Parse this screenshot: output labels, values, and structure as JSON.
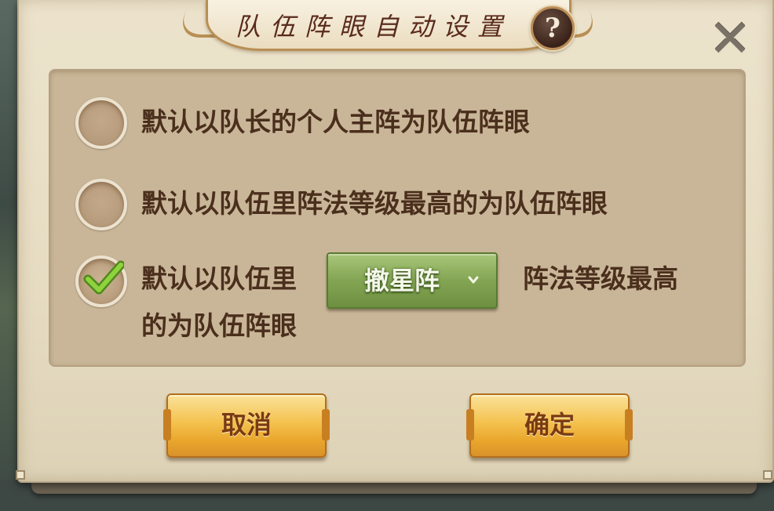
{
  "dialog": {
    "title": "队伍阵眼自动设置",
    "help_glyph": "?",
    "close_glyph": "✕"
  },
  "options": [
    {
      "label": "默认以队长的个人主阵为队伍阵眼",
      "checked": false
    },
    {
      "label": "默认以队伍里阵法等级最高的为队伍阵眼",
      "checked": false
    },
    {
      "label_before": "默认以队伍里",
      "label_after": "阵法等级最高",
      "label_line2": "的为队伍阵眼",
      "checked": true
    }
  ],
  "formation_select": {
    "value": "撤星阵"
  },
  "buttons": {
    "cancel": "取消",
    "confirm": "确定"
  },
  "colors": {
    "parchment": "#e6dcc2",
    "panel": "#c9b698",
    "text": "#4a2f1d",
    "title": "#5a2b1c",
    "select_green": "#83a553",
    "button_gold": "#f4c24f",
    "check_green": "#7fc232"
  },
  "icons": {
    "help": "question-mark-icon",
    "close": "close-x-icon",
    "check": "checkmark-icon",
    "dropdown": "chevron-down-icon"
  }
}
